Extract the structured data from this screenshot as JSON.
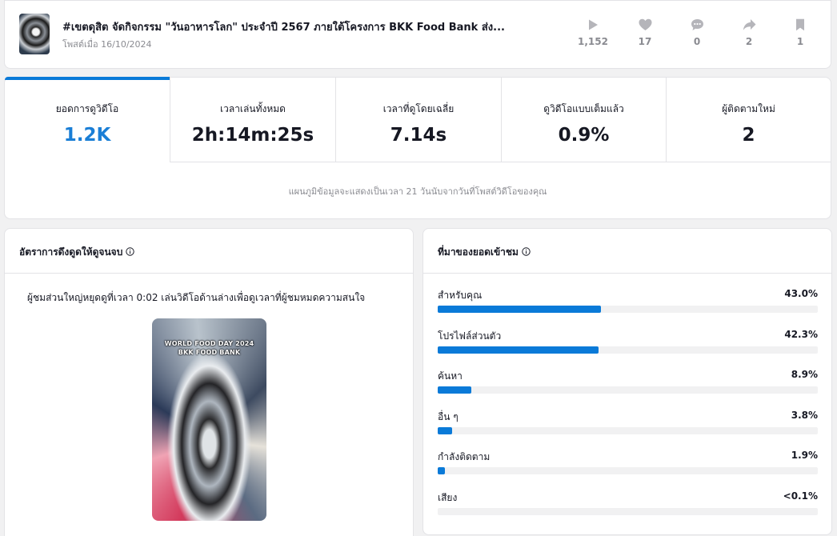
{
  "header": {
    "title": "#เขตดุสิต จัดกิจกรรม \"วันอาหารโลก\" ประจำปี 2567 ภายใต้โครงการ BKK Food Bank ส่ง...",
    "date": "โพสต์เมื่อ 16/10/2024",
    "stats": [
      {
        "icon": "play-icon",
        "value": "1,152"
      },
      {
        "icon": "heart-icon",
        "value": "17"
      },
      {
        "icon": "comment-icon",
        "value": "0"
      },
      {
        "icon": "share-icon",
        "value": "2"
      },
      {
        "icon": "bookmark-icon",
        "value": "1"
      }
    ]
  },
  "metrics": {
    "items": [
      {
        "label": "ยอดการดูวิดีโอ",
        "value": "1.2K"
      },
      {
        "label": "เวลาเล่นทั้งหมด",
        "value": "2h:14m:25s"
      },
      {
        "label": "เวลาที่ดูโดยเฉลี่ย",
        "value": "7.14s"
      },
      {
        "label": "ดูวิดีโอแบบเต็มแล้ว",
        "value": "0.9%"
      },
      {
        "label": "ผู้ติดตามใหม่",
        "value": "2"
      }
    ],
    "note": "แผนภูมิข้อมูลจะแสดงเป็นเวลา 21 วันนับจากวันที่โพสต์วิดีโอของคุณ"
  },
  "retention": {
    "title": "อัตราการดึงดูดให้ดูจนจบ",
    "description": "ผู้ชมส่วนใหญ่หยุดดูที่เวลา 0:02 เล่นวิดีโอด้านล่างเพื่อดูเวลาที่ผู้ชมหมดความสนใจ",
    "video_line1": "WORLD FOOD DAY 2024",
    "video_line2": "BKK FOOD BANK"
  },
  "traffic": {
    "title": "ที่มาของยอดเข้าชม",
    "sources": [
      {
        "name": "สำหรับคุณ",
        "pct": "43.0%",
        "fraction": 0.43
      },
      {
        "name": "โปรไฟล์ส่วนตัว",
        "pct": "42.3%",
        "fraction": 0.423
      },
      {
        "name": "ค้นหา",
        "pct": "8.9%",
        "fraction": 0.089
      },
      {
        "name": "อื่น ๆ",
        "pct": "3.8%",
        "fraction": 0.038
      },
      {
        "name": "กำลังติดตาม",
        "pct": "1.9%",
        "fraction": 0.019
      },
      {
        "name": "เสียง",
        "pct": "<0.1%",
        "fraction": 0.0
      }
    ]
  },
  "colors": {
    "accent": "#0a7ad8",
    "track": "#f1f1f2",
    "muted": "#8a8b91"
  }
}
